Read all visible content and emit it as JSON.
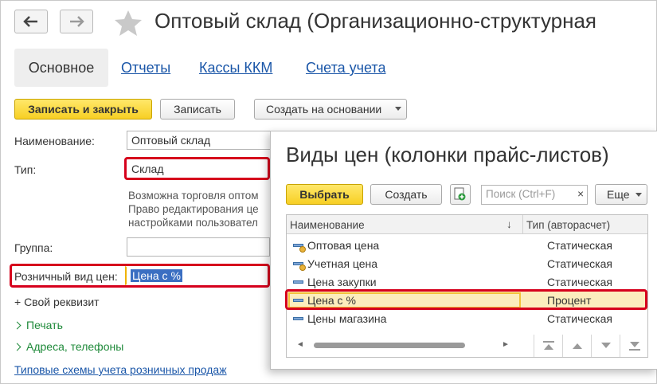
{
  "window": {
    "title": "Оптовый склад (Организационно-структурная"
  },
  "nav": {
    "back_icon": "arrow-left-icon",
    "forward_icon": "arrow-right-icon",
    "favorite_icon": "star-icon"
  },
  "tabs": [
    {
      "label": "Основное",
      "active": true
    },
    {
      "label": "Отчеты"
    },
    {
      "label": "Кассы ККМ"
    },
    {
      "label": "Счета учета"
    }
  ],
  "toolbar": {
    "save_close": "Записать и закрыть",
    "save": "Записать",
    "create_based": "Создать на основании"
  },
  "form": {
    "name_label": "Наименование:",
    "name_value": "Оптовый склад",
    "type_label": "Тип:",
    "type_value": "Склад",
    "hint_lines": [
      "Возможна торговля оптом",
      "Право редактирования це",
      "настройками пользовател"
    ],
    "group_label": "Группа:",
    "group_value": "",
    "retail_price_label": "Розничный вид цен:",
    "retail_price_value": "Цена с %",
    "own_attr": "+ Свой реквизит",
    "print": "Печать",
    "addresses": "Адреса, телефоны",
    "schemes_link": "Типовые схемы учета розничных продаж"
  },
  "popup": {
    "title": "Виды цен (колонки прайс-листов)",
    "select_btn": "Выбрать",
    "create_btn": "Создать",
    "search_placeholder": "Поиск (Ctrl+F)",
    "clear": "×",
    "more_btn": "Еще",
    "col_name": "Наименование",
    "col_sort": "↓",
    "col_type": "Тип (авторасчет)",
    "rows": [
      {
        "name": "Оптовая цена",
        "type": "Статическая",
        "marked": true
      },
      {
        "name": "Учетная цена",
        "type": "Статическая",
        "marked": true
      },
      {
        "name": "Цена закупки",
        "type": "Статическая",
        "marked": false
      },
      {
        "name": "Цена с %",
        "type": "Процент",
        "marked": false,
        "selected": true
      },
      {
        "name": "Цены магазина",
        "type": "Статическая",
        "marked": false
      }
    ]
  },
  "colors": {
    "accent_red": "#d6001c",
    "link_blue": "#1a56a8",
    "yellow_button": "#f7cf24",
    "green_link": "#1f8a3a",
    "selected_row": "#fcedbd"
  }
}
